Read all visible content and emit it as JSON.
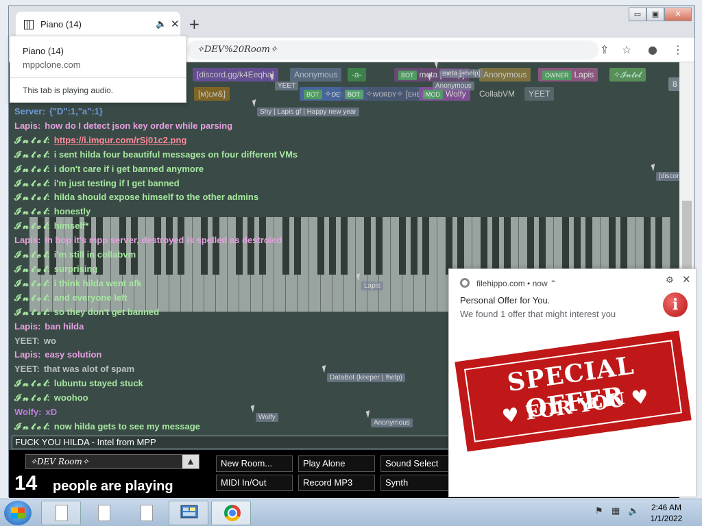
{
  "browser": {
    "tab_title": "Piano (14)",
    "url_display": "✧DEV%20Room✧",
    "controls": {
      "minimize": "▭",
      "maximize": "▣",
      "close": "✕"
    },
    "new_tab": "+",
    "tab_close": "✕"
  },
  "hovercard": {
    "title": "Piano (14)",
    "domain": "mppclone.com",
    "audio_note": "This tab is playing audio."
  },
  "namebar": [
    {
      "label": "[discord.gg/k4Eeqha]",
      "bg": "#6d4ea0",
      "fg": "#ddd"
    },
    {
      "label": "Anonymous",
      "bg": "#5c6f88",
      "fg": "#c8d0e0"
    },
    {
      "label": "-a-",
      "bg": "#3f8a4a",
      "fg": "#dfe"
    },
    {
      "label": "meta [=help]",
      "role": "BOT",
      "bg": "#6e4a7a",
      "fg": "#eee"
    },
    {
      "label": "Anonymous",
      "bg": "#8a7a40",
      "fg": "#ddd"
    },
    {
      "label": "Lapis",
      "role": "OWNER",
      "bg": "#9a5a8a",
      "fg": "#fff"
    },
    {
      "label": "✧𝓘𝓷𝓽𝓮𝓵",
      "bg": "#5e9a5a",
      "fg": "#cfe"
    },
    {
      "label": "[ᴍ)ʟᴍ&]",
      "bg": "#8a6a20",
      "fg": "#ddd"
    },
    {
      "label": "✧ᴅᴇᴠ help]",
      "role": "BOT",
      "bg": "#4a6aaa",
      "fg": "#eee"
    },
    {
      "label": "✧ᴡᴏʀᴅʏ✧ [ᴇʜᴇʟᴘ]",
      "role": "BOT",
      "bg": "#4a5a7a",
      "fg": "#ccc"
    },
    {
      "label": "Wolfy",
      "role": "MOD",
      "bg": "#8a50a0",
      "fg": "#eee"
    },
    {
      "label": "CollabVM",
      "bg": "#3a4a46",
      "fg": "#ddd"
    },
    {
      "label": "YEET",
      "bg": "#5a6a70",
      "fg": "#ddd"
    },
    {
      "label": "8",
      "bg": "#7a8a90",
      "fg": "#fff"
    }
  ],
  "cursors": [
    {
      "label": "YEET"
    },
    {
      "label": "meta [=help]"
    },
    {
      "label": "Anonymous"
    },
    {
      "label": "Shy | Lapis gf | Happy new year"
    },
    {
      "label": "[discord...]"
    },
    {
      "label": "Lapis"
    },
    {
      "label": "DataBot (keeper | !help)"
    },
    {
      "label": "Wolfy"
    },
    {
      "label": "Anonymous"
    }
  ],
  "chat": [
    {
      "nick": "Server:",
      "nick_color": "#6f9ad8",
      "text": "{\"D\":1,\"a\":1}",
      "text_color": "#6f9ad8"
    },
    {
      "nick": "Lapis:",
      "nick_color": "#e6a0e0",
      "text": "how do I detect json key order while parsing",
      "text_color": "#e6a0e0"
    },
    {
      "nick": "𝓘 𝓷 𝓽 𝓮 𝓵:",
      "nick_color": "#a6e8a0",
      "text": "https://i.imgur.com/rSj01c2.png",
      "text_color": "#ff8a9a"
    },
    {
      "nick": "𝓘 𝓷 𝓽 𝓮 𝓵:",
      "nick_color": "#a6e8a0",
      "text": "i sent hilda four beautiful messages on four different VMs",
      "text_color": "#a6e8a0"
    },
    {
      "nick": "𝓘 𝓷 𝓽 𝓮 𝓵:",
      "nick_color": "#a6e8a0",
      "text": "i don't care if i get banned anymore",
      "text_color": "#a6e8a0"
    },
    {
      "nick": "𝓘 𝓷 𝓽 𝓮 𝓵:",
      "nick_color": "#a6e8a0",
      "text": "i'm just testing if I get banned",
      "text_color": "#a6e8a0"
    },
    {
      "nick": "𝓘 𝓷 𝓽 𝓮 𝓵:",
      "nick_color": "#a6e8a0",
      "text": "hilda should expose himself to the other admins",
      "text_color": "#a6e8a0"
    },
    {
      "nick": "𝓘 𝓷 𝓽 𝓮 𝓵:",
      "nick_color": "#a6e8a0",
      "text": "honestly",
      "text_color": "#a6e8a0"
    },
    {
      "nick": "𝓘 𝓷 𝓽 𝓮 𝓵:",
      "nick_color": "#a6e8a0",
      "text": "himself*",
      "text_color": "#a6e8a0"
    },
    {
      "nick": "Lapis:",
      "nick_color": "#e6a0e0",
      "text": "in bop it's mpp server, destroyed is spelled as destroied",
      "text_color": "#e6a0e0"
    },
    {
      "nick": "𝓘 𝓷 𝓽 𝓮 𝓵:",
      "nick_color": "#a6e8a0",
      "text": "i'm still in collabvm",
      "text_color": "#a6e8a0"
    },
    {
      "nick": "𝓘 𝓷 𝓽 𝓮 𝓵:",
      "nick_color": "#a6e8a0",
      "text": "surprising",
      "text_color": "#a6e8a0"
    },
    {
      "nick": "𝓘 𝓷 𝓽 𝓮 𝓵:",
      "nick_color": "#a6e8a0",
      "text": "i think hilda went afk",
      "text_color": "#a6e8a0"
    },
    {
      "nick": "𝓘 𝓷 𝓽 𝓮 𝓵:",
      "nick_color": "#a6e8a0",
      "text": "and everyone left",
      "text_color": "#a6e8a0"
    },
    {
      "nick": "𝓘 𝓷 𝓽 𝓮 𝓵:",
      "nick_color": "#a6e8a0",
      "text": "so they don't get banned",
      "text_color": "#a6e8a0"
    },
    {
      "nick": "Lapis:",
      "nick_color": "#e6a0e0",
      "text": "ban hilda",
      "text_color": "#e6a0e0"
    },
    {
      "nick": "YEET:",
      "nick_color": "#b8c0c0",
      "text": "wo",
      "text_color": "#b8c0c0"
    },
    {
      "nick": "Lapis:",
      "nick_color": "#e6a0e0",
      "text": "easy solution",
      "text_color": "#e6a0e0"
    },
    {
      "nick": "YEET:",
      "nick_color": "#b8c0c0",
      "text": "that was alot of spam",
      "text_color": "#b8c0c0"
    },
    {
      "nick": "𝓘 𝓷 𝓽 𝓮 𝓵:",
      "nick_color": "#a6e8a0",
      "text": "lubuntu stayed stuck",
      "text_color": "#a6e8a0"
    },
    {
      "nick": "𝓘 𝓷 𝓽 𝓮 𝓵:",
      "nick_color": "#a6e8a0",
      "text": "woohoo",
      "text_color": "#a6e8a0"
    },
    {
      "nick": "Wolfy:",
      "nick_color": "#c07ae0",
      "text": "xD",
      "text_color": "#c07ae0"
    },
    {
      "nick": "𝓘 𝓷 𝓽 𝓮 𝓵:",
      "nick_color": "#a6e8a0",
      "text": "now hilda gets to see my message",
      "text_color": "#a6e8a0"
    }
  ],
  "chat_input": {
    "value": "FUCK YOU HILDA - Intel from MPP"
  },
  "bottom": {
    "room": "✧DEV Room✧",
    "count": "14",
    "count_label": "people are playing",
    "buttons": [
      "New Room...",
      "Play Alone",
      "Sound Select",
      "MIDI In/Out",
      "Record MP3",
      "Synth"
    ]
  },
  "notification": {
    "source": "filehippo.com",
    "time": "now",
    "title": "Personal Offer for You.",
    "body": "We found 1 offer that might interest you",
    "offer_line1": "SPECIAL OFFER",
    "offer_line2": "♥ FOR YOU ♥"
  },
  "taskbar": {
    "time": "2:46 AM",
    "date": "1/1/2022"
  }
}
